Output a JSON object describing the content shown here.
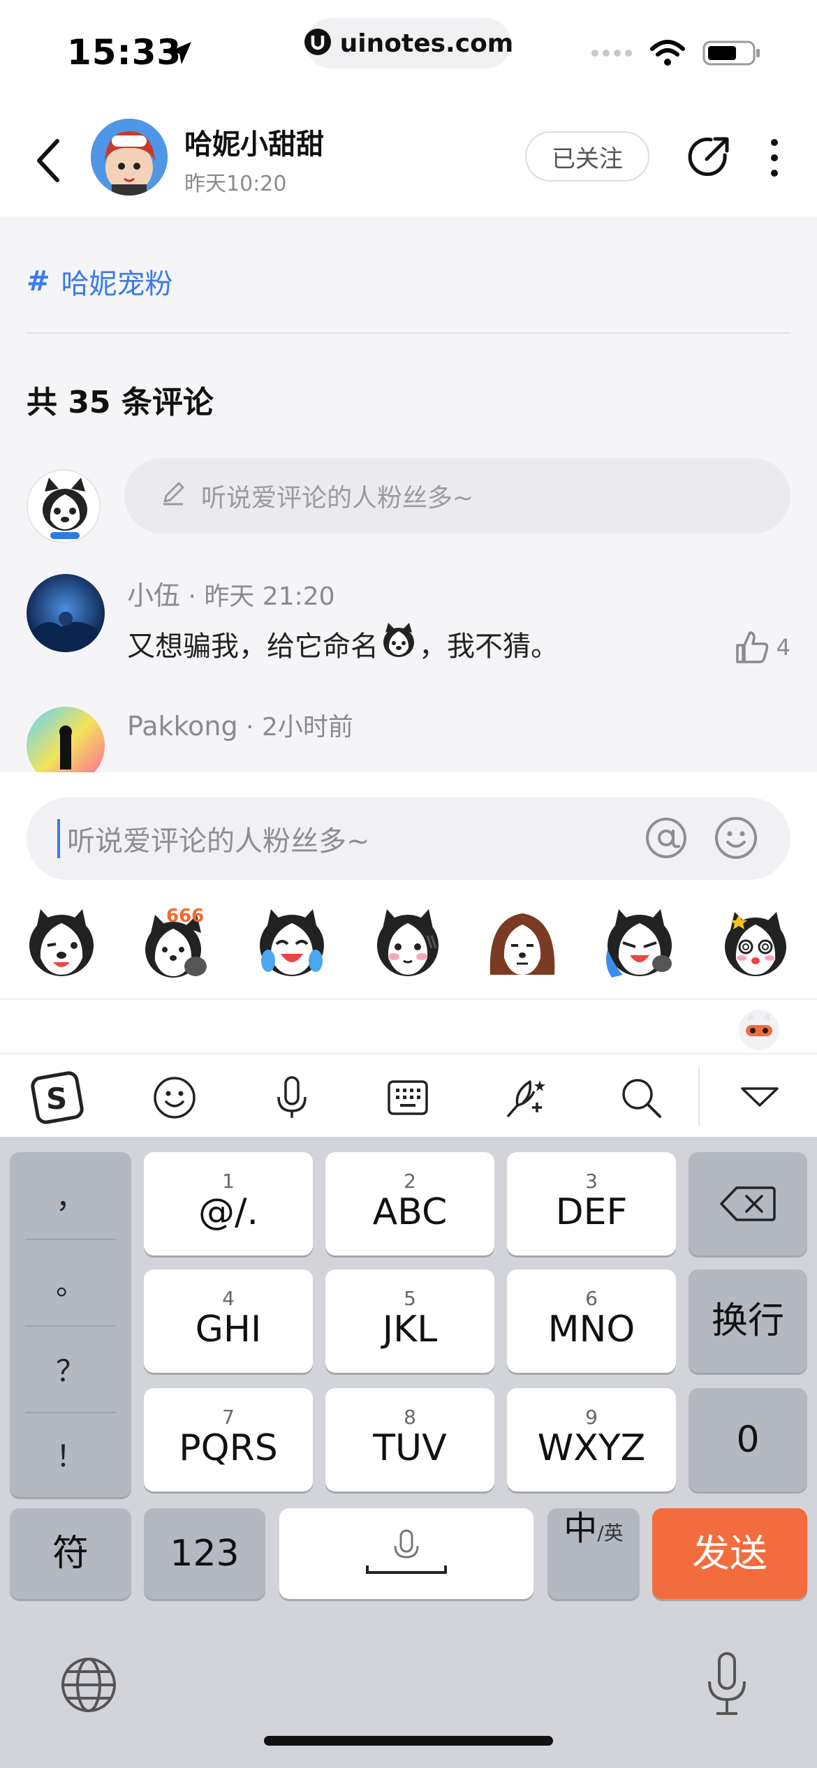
{
  "status_bar": {
    "time": "15:33",
    "url": "uinotes.com"
  },
  "header": {
    "author_name": "哈妮小甜甜",
    "post_time": "昨天10:20",
    "follow_label": "已关注"
  },
  "post": {
    "topic_hash": "#",
    "topic": "哈妮宠粉"
  },
  "comments_section": {
    "count_label": "共 35 条评论",
    "input_placeholder": "听说爱评论的人粉丝多~",
    "comments": [
      {
        "user": "小伍",
        "time": "· 昨天 21:20",
        "text_before": "又想骗我，给它命名",
        "text_after": "，我不猜。",
        "likes": "4"
      },
      {
        "user": "Pakkong",
        "time": "· 2小时前"
      }
    ]
  },
  "reply_bar": {
    "placeholder": "听说爱评论的人粉丝多~",
    "stickers": [
      "wink-husky",
      "666-husky",
      "laugh-cry-husky",
      "shy-husky",
      "hair-husky",
      "crying-husky",
      "dizzy-husky"
    ]
  },
  "keyboard": {
    "punctuation": [
      "，",
      "。",
      "？",
      "！"
    ],
    "keys": [
      {
        "num": "1",
        "label": "@/."
      },
      {
        "num": "2",
        "label": "ABC"
      },
      {
        "num": "3",
        "label": "DEF"
      },
      {
        "num": "4",
        "label": "GHI"
      },
      {
        "num": "5",
        "label": "JKL"
      },
      {
        "num": "6",
        "label": "MNO"
      },
      {
        "num": "7",
        "label": "PQRS"
      },
      {
        "num": "8",
        "label": "TUV"
      },
      {
        "num": "9",
        "label": "WXYZ"
      }
    ],
    "newline_label": "换行",
    "zero_label": "0",
    "symbol_label": "符",
    "numbers_label": "123",
    "lang_main": "中",
    "lang_sub": "/英",
    "send_label": "发送"
  },
  "colors": {
    "accent_blue": "#3a7be8",
    "send_orange": "#f36c3d",
    "keyboard_bg": "#d2d4da"
  }
}
